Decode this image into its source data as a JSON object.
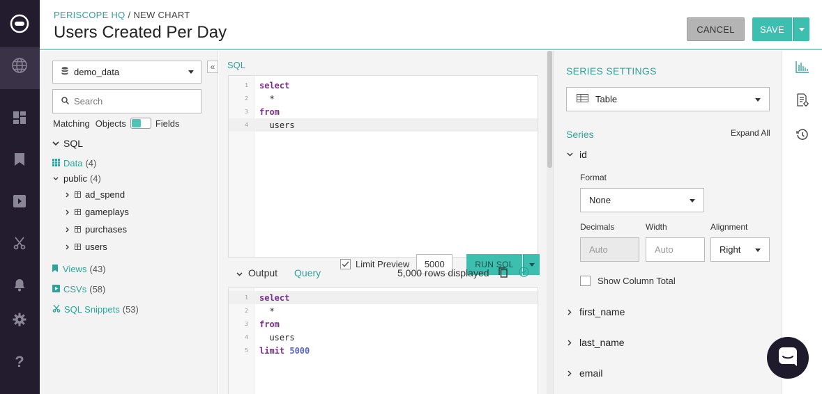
{
  "colors": {
    "accent": "#3dbfb0",
    "accent_text": "#2fa399",
    "rail": "#221c2e",
    "cancel": "#b4b4b4",
    "keyword": "#7b2f8c",
    "number": "#5666c6"
  },
  "rail": {
    "icons": [
      "logo-icon",
      "globe-icon",
      "dashboard-icon",
      "bookmark-icon",
      "view-icon",
      "snippet-icon",
      "bell-icon",
      "gear-icon",
      "help-icon"
    ]
  },
  "header": {
    "breadcrumb_root": "PERISCOPE HQ",
    "breadcrumb_sep": " / ",
    "breadcrumb_current": "NEW CHART",
    "title": "Users Created Per Day",
    "cancel_label": "CANCEL",
    "save_label": "SAVE"
  },
  "schema": {
    "database": "demo_data",
    "search_placeholder": "Search",
    "matching_label": "Matching",
    "objects_label": "Objects",
    "fields_label": "Fields",
    "sql_label": "SQL",
    "data_label": "Data",
    "data_count": "(4)",
    "public_label": "public",
    "public_count": "(4)",
    "tables": [
      "ad_spend",
      "gameplays",
      "purchases",
      "users"
    ],
    "views_label": "Views",
    "views_count": "(43)",
    "csvs_label": "CSVs",
    "csvs_count": "(58)",
    "snippets_label": "SQL Snippets",
    "snippets_count": "(53)"
  },
  "editor": {
    "section_label": "SQL",
    "lines": [
      {
        "n": "1",
        "parts": [
          {
            "t": "select",
            "c": "kw"
          }
        ]
      },
      {
        "n": "2",
        "parts": [
          {
            "t": "  *",
            "c": ""
          }
        ]
      },
      {
        "n": "3",
        "parts": [
          {
            "t": "from",
            "c": "kw"
          }
        ]
      },
      {
        "n": "4",
        "parts": [
          {
            "t": "  users",
            "c": ""
          }
        ]
      }
    ],
    "limit_preview_label": "Limit Preview",
    "limit_value": "5000",
    "run_label": "RUN SQL"
  },
  "output": {
    "output_label": "Output",
    "query_label": "Query",
    "rows_displayed": "5,000 rows displayed",
    "lines": [
      {
        "n": "1",
        "parts": [
          {
            "t": "select",
            "c": "kw"
          }
        ]
      },
      {
        "n": "2",
        "parts": [
          {
            "t": "  *",
            "c": ""
          }
        ]
      },
      {
        "n": "3",
        "parts": [
          {
            "t": "from",
            "c": "kw"
          }
        ]
      },
      {
        "n": "4",
        "parts": [
          {
            "t": "  users",
            "c": ""
          }
        ]
      },
      {
        "n": "5",
        "parts": [
          {
            "t": "limit",
            "c": "kw"
          },
          {
            "t": " ",
            "c": ""
          },
          {
            "t": "5000",
            "c": "num"
          }
        ]
      }
    ]
  },
  "series": {
    "title": "SERIES SETTINGS",
    "chart_type": "Table",
    "series_label": "Series",
    "expand_all": "Expand All",
    "expanded_field": "id",
    "format_label": "Format",
    "format_value": "None",
    "decimals_label": "Decimals",
    "decimals_placeholder": "Auto",
    "width_label": "Width",
    "width_placeholder": "Auto",
    "alignment_label": "Alignment",
    "alignment_value": "Right",
    "show_total_label": "Show Column Total",
    "collapsed_fields": [
      "first_name",
      "last_name",
      "email"
    ]
  }
}
